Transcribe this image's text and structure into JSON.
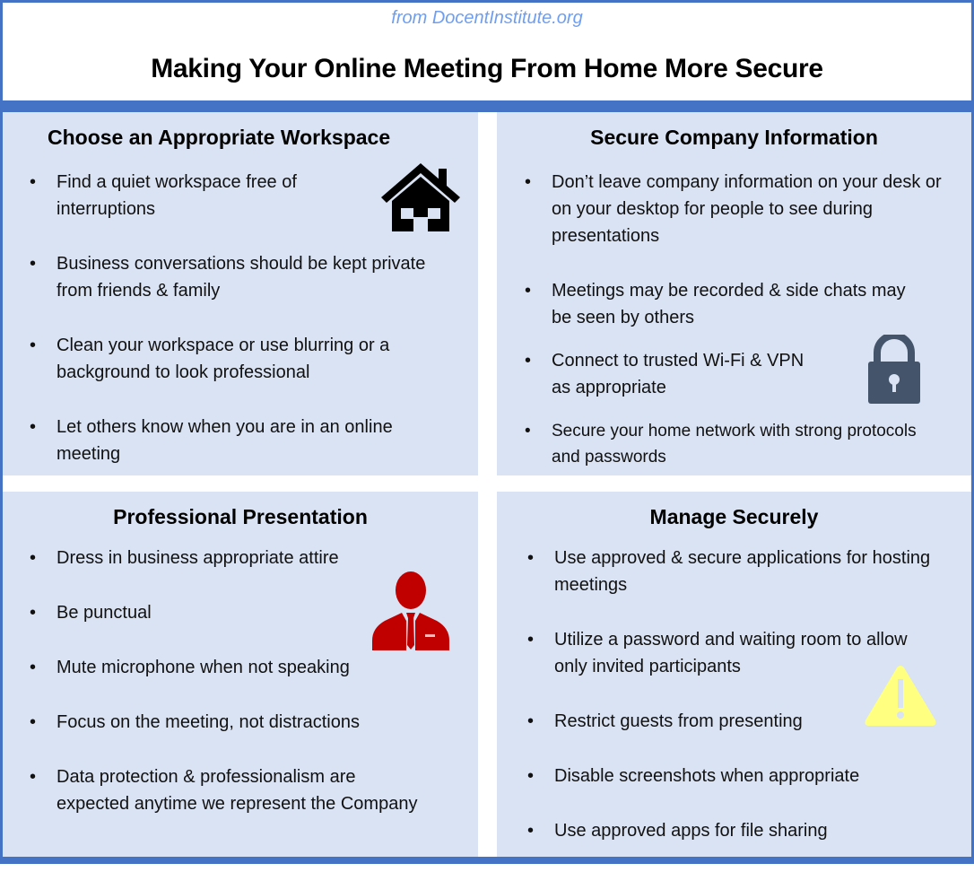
{
  "header": {
    "source": "from DocentInstitute.org",
    "title": "Making Your Online Meeting From Home More Secure"
  },
  "colors": {
    "accent": "#4472c4",
    "panel": "#dae3f3",
    "source_text": "#6f9ef0",
    "person_icon": "#c00000",
    "lock_icon": "#44546a",
    "warning_icon": "#ffff80"
  },
  "sections": [
    {
      "heading": "Choose an Appropriate Workspace",
      "icon": "house-icon",
      "items": [
        "Find a quiet workspace free of interruptions",
        "Business conversations should be kept private from friends & family",
        "Clean your workspace or use blurring or a background to look professional",
        "Let others know when you are in an online meeting"
      ]
    },
    {
      "heading": "Secure Company Information",
      "icon": "lock-icon",
      "items": [
        "Don’t leave company information on your desk or on your desktop for people to see during presentations",
        "Meetings may be recorded & side chats may be seen by others",
        "Connect to trusted Wi-Fi & VPN as appropriate",
        "Secure your home network with strong protocols and passwords"
      ]
    },
    {
      "heading": "Professional Presentation",
      "icon": "businessperson-icon",
      "items": [
        "Dress in business appropriate attire",
        "Be punctual",
        "Mute microphone when not speaking",
        "Focus on the meeting, not distractions",
        "Data protection & professionalism are expected anytime we represent the Company"
      ]
    },
    {
      "heading": "Manage Securely",
      "icon": "warning-icon",
      "items": [
        "Use approved & secure applications for hosting meetings",
        "Utilize a password and waiting room to allow only invited participants",
        "Restrict guests from presenting",
        "Disable screenshots when appropriate",
        "Use approved apps for file sharing"
      ]
    }
  ]
}
